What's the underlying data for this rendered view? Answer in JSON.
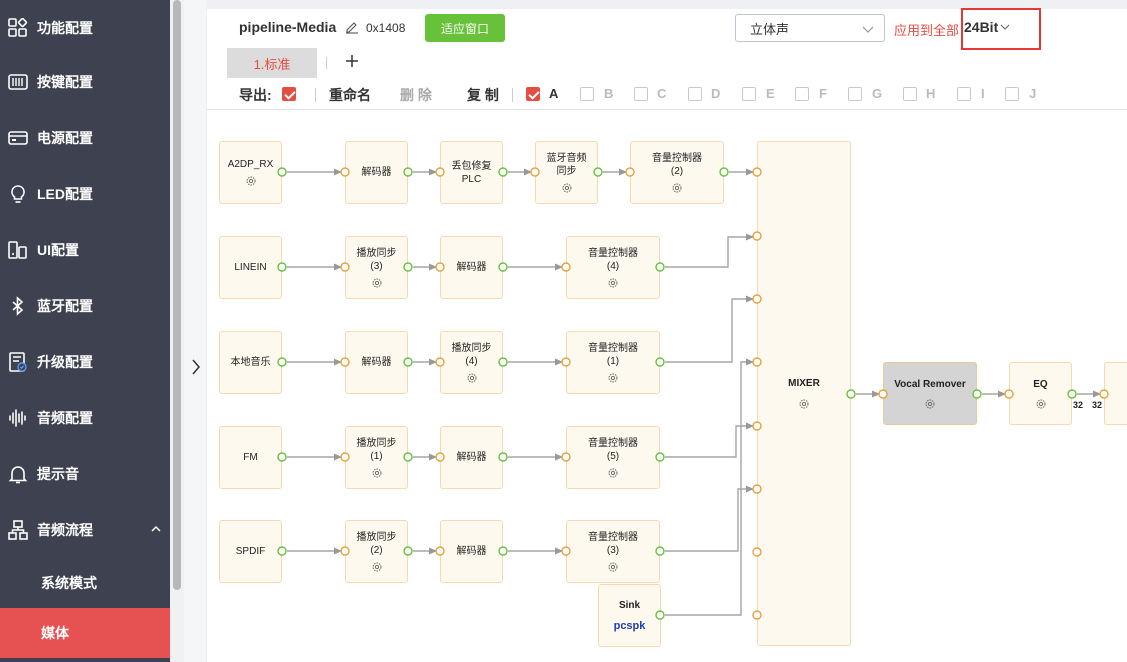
{
  "sidebar": {
    "items": [
      {
        "label": "功能配置",
        "icon": "grid-icon"
      },
      {
        "label": "按键配置",
        "icon": "keyboard-icon"
      },
      {
        "label": "电源配置",
        "icon": "battery-icon"
      },
      {
        "label": "LED配置",
        "icon": "bulb-icon"
      },
      {
        "label": "UI配置",
        "icon": "ui-icon"
      },
      {
        "label": "蓝牙配置",
        "icon": "bluetooth-icon"
      },
      {
        "label": "升级配置",
        "icon": "upgrade-icon"
      },
      {
        "label": "音频配置",
        "icon": "waveform-icon"
      },
      {
        "label": "提示音",
        "icon": "bell-icon"
      },
      {
        "label": "音频流程",
        "icon": "flow-icon",
        "expanded": true
      }
    ],
    "sub_items": [
      {
        "label": "系统模式",
        "active": false
      },
      {
        "label": "媒体",
        "active": true
      }
    ]
  },
  "header": {
    "title": "pipeline-Media",
    "address": "0x1408",
    "fit_button": "适应窗口",
    "channel_select": "立体声",
    "apply_all": "应用到全部",
    "bit_depth": "24Bit"
  },
  "tabs": [
    {
      "label": "1.标准",
      "active": true
    }
  ],
  "toolbar": {
    "export_label": "导出:",
    "export_checked": true,
    "rename_label": "重命名",
    "delete_label": "删 除",
    "copy_label": "复 制",
    "presets": [
      {
        "label": "A",
        "checked": true
      },
      {
        "label": "B",
        "checked": false
      },
      {
        "label": "C",
        "checked": false
      },
      {
        "label": "D",
        "checked": false
      },
      {
        "label": "E",
        "checked": false
      },
      {
        "label": "F",
        "checked": false
      },
      {
        "label": "G",
        "checked": false
      },
      {
        "label": "H",
        "checked": false
      },
      {
        "label": "I",
        "checked": false
      },
      {
        "label": "J",
        "checked": false
      }
    ]
  },
  "pipeline": {
    "sources": [
      "A2DP_RX",
      "LINEIN",
      "本地音乐",
      "FM",
      "SPDIF"
    ],
    "decoder": "解码器",
    "plc": "丢包修复\nPLC",
    "bt_sync": "蓝牙音频\n同步",
    "volume": [
      "音量控制器\n(2)",
      "音量控制器\n(4)",
      "音量控制器\n(1)",
      "音量控制器\n(5)",
      "音量控制器\n(3)"
    ],
    "play_sync": [
      "播放同步\n(3)",
      "播放同步\n(4)",
      "播放同步\n(1)",
      "播放同步\n(2)"
    ],
    "sink": {
      "label": "Sink",
      "value": "pcspk"
    },
    "mixer": "MIXER",
    "vocal_remover": "Vocal Remover",
    "eq": "EQ",
    "bit_labels": [
      "32",
      "32"
    ]
  },
  "colors": {
    "sidebar_bg": "#3d4150",
    "active_red": "#e65252",
    "fit_green": "#67c23a",
    "node_bg": "#fef9ee",
    "node_border": "#f6d9b2",
    "port_out": "#67c23a",
    "port_in": "#e6a23c"
  }
}
